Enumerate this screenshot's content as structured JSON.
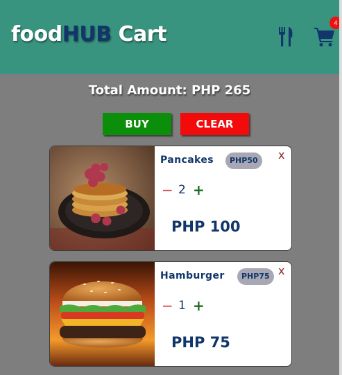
{
  "header": {
    "brand_part1": "food",
    "brand_part2": "HUB",
    "brand_part3": " Cart",
    "cart_count": "4",
    "nav_icons": [
      "utensils-icon",
      "cart-icon"
    ],
    "colors": {
      "bar": "#38937f",
      "brand_hub": "#12366a",
      "badge": "#ee1111"
    }
  },
  "summary": {
    "total_label": "Total Amount: PHP 265"
  },
  "actions": {
    "buy_label": "BUY",
    "clear_label": "CLEAR",
    "colors": {
      "buy": "#0b8f0b",
      "clear": "#f30a0a"
    }
  },
  "cart_items": [
    {
      "name": "Pancakes",
      "unit_price": "PHP50",
      "quantity": "2",
      "subtotal": "PHP 100",
      "remove_label": "x",
      "minus_label": "−",
      "plus_label": "+",
      "image": "pancakes-photo"
    },
    {
      "name": "Hamburger",
      "unit_price": "PHP75",
      "quantity": "1",
      "subtotal": "PHP 75",
      "remove_label": "x",
      "minus_label": "−",
      "plus_label": "+",
      "image": "hamburger-photo"
    }
  ]
}
